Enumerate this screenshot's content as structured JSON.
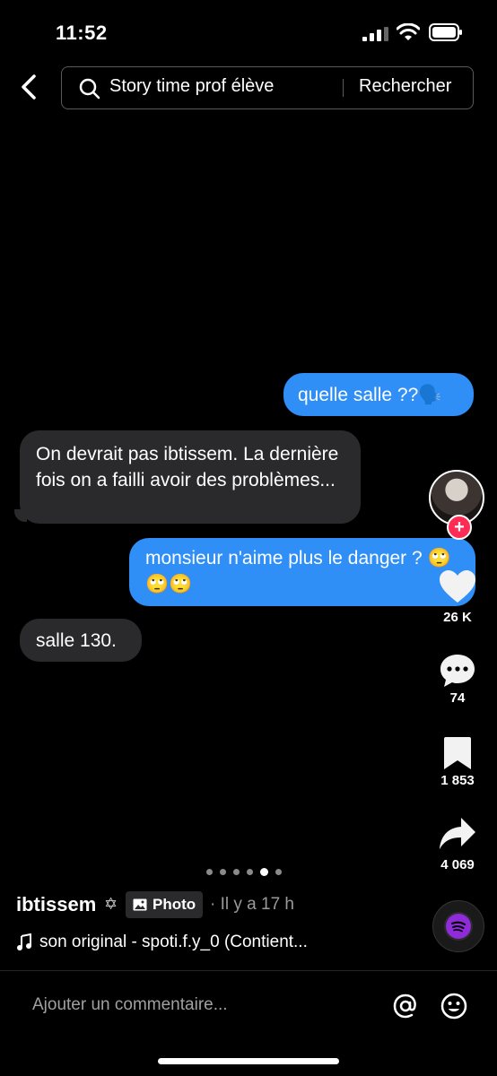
{
  "status_bar": {
    "time": "11:52"
  },
  "search": {
    "query": "Story time prof élève",
    "button_label": "Rechercher"
  },
  "messages": [
    {
      "side": "sent",
      "text": "quelle salle ??🗣️"
    },
    {
      "side": "received",
      "text": "On devrait pas ibtissem. La dernière fois on a failli avoir des problèmes..."
    },
    {
      "side": "sent",
      "text": "monsieur n'aime plus le danger ? 🙄🙄🙄"
    },
    {
      "side": "received",
      "text": "salle 130."
    }
  ],
  "actions": {
    "likes": "26 K",
    "comments": "74",
    "saves": "1 853",
    "shares": "4 069"
  },
  "carousel": {
    "total": 6,
    "active_index": 4
  },
  "post": {
    "username": "ibtissem",
    "username_symbol": "✡",
    "badge_label": "Photo",
    "time_ago": "· Il y a 17 h",
    "sound": "son original - spoti.f.y_0 (Contient..."
  },
  "comment_bar": {
    "placeholder": "Ajouter un commentaire..."
  },
  "colors": {
    "sent_bubble": "#2f8ff7",
    "received_bubble": "#2a2a2c",
    "follow_badge": "#fe2c55"
  }
}
